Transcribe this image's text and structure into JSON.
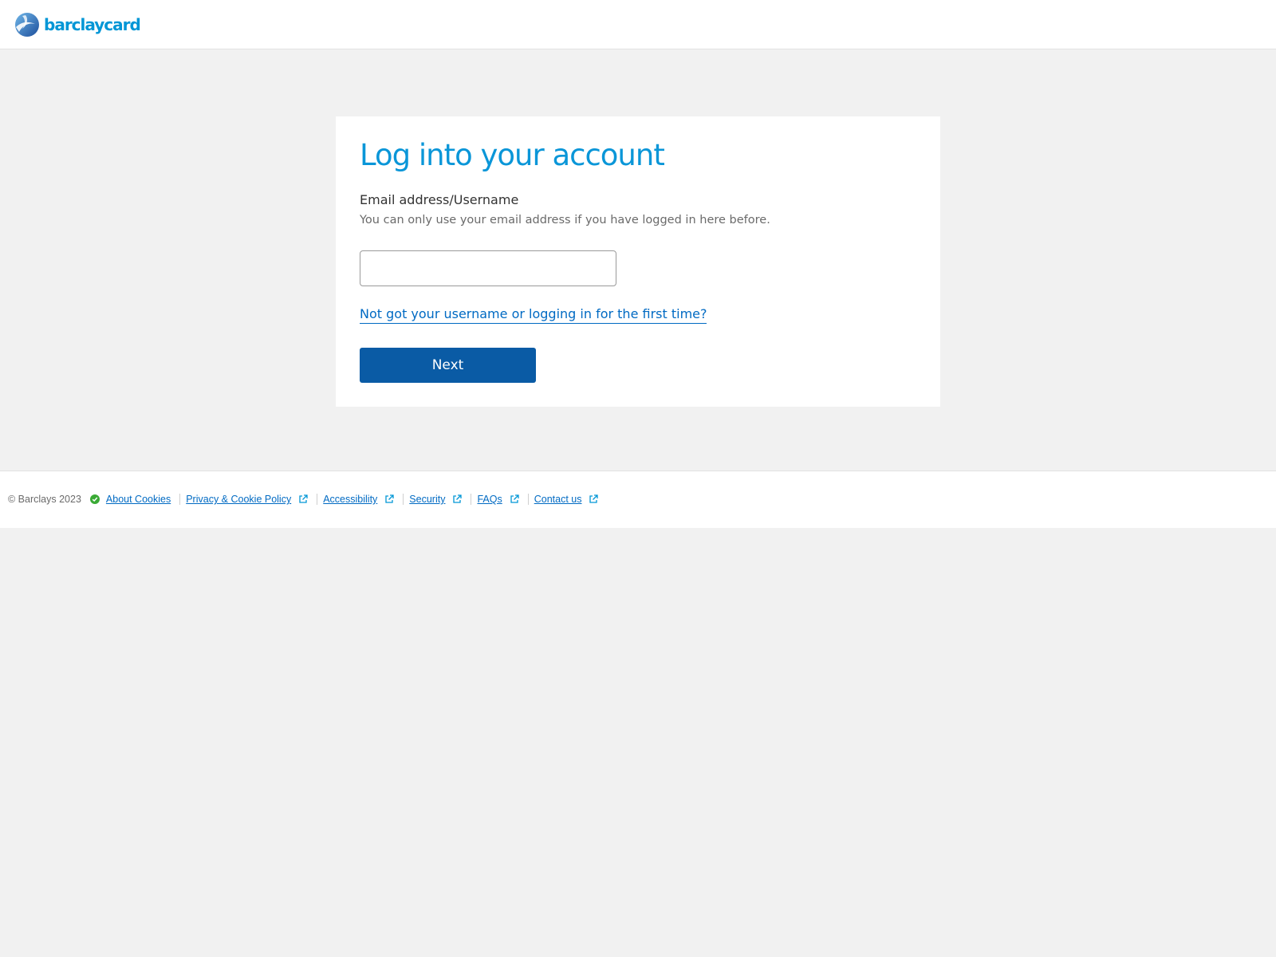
{
  "header": {
    "logo_text": "barclaycard"
  },
  "login": {
    "title": "Log into your account",
    "field_label": "Email address/Username",
    "field_hint": "You can only use your email address if you have logged in here before.",
    "input_value": "",
    "help_link": "Not got your username or logging in for the first time?",
    "next_label": "Next"
  },
  "footer": {
    "copyright": "© Barclays 2023",
    "links": [
      {
        "label": "About Cookies"
      },
      {
        "label": "Privacy & Cookie Policy"
      },
      {
        "label": "Accessibility"
      },
      {
        "label": "Security"
      },
      {
        "label": "FAQs"
      },
      {
        "label": "Contact us"
      }
    ]
  },
  "colors": {
    "brand_blue": "#0a96d8",
    "button_blue": "#0a5ba5",
    "link_blue": "#006ac3",
    "background": "#f1f1f1",
    "cookie_check": "#3aaa35"
  }
}
